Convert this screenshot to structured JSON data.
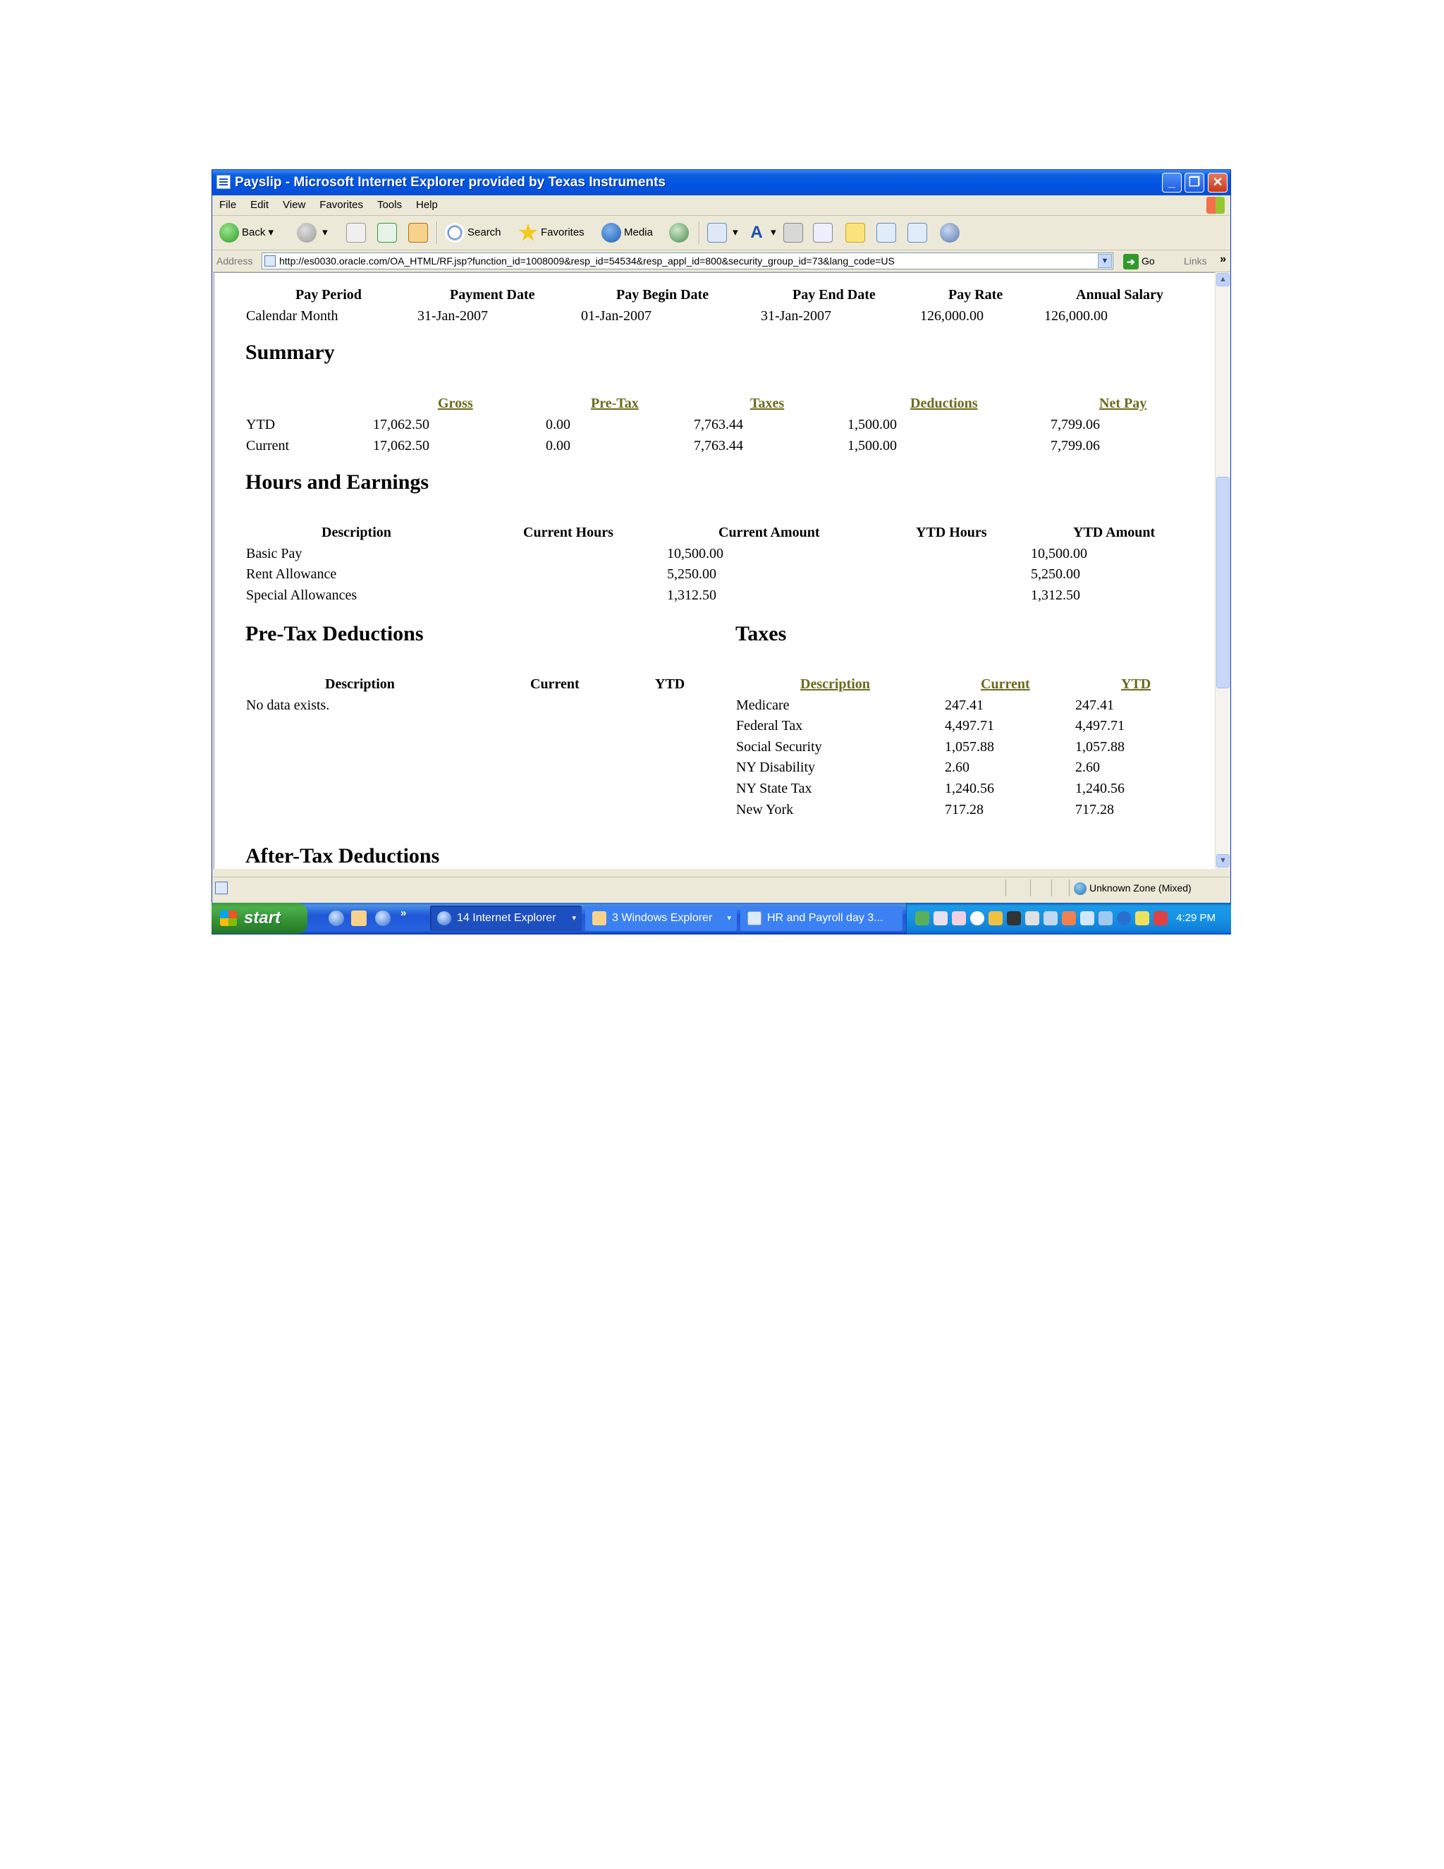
{
  "window": {
    "title": "Payslip - Microsoft Internet Explorer provided by Texas Instruments",
    "min_glyph": "_",
    "max_glyph": "❐",
    "close_glyph": "✕"
  },
  "menu": [
    "File",
    "Edit",
    "View",
    "Favorites",
    "Tools",
    "Help"
  ],
  "toolbar": {
    "back": "Back",
    "search": "Search",
    "favorites": "Favorites",
    "media": "Media",
    "font_glyph": "A"
  },
  "address": {
    "label": "Address",
    "url": "http://es0030.oracle.com/OA_HTML/RF.jsp?function_id=1008009&resp_id=54534&resp_appl_id=800&security_group_id=73&lang_code=US",
    "go": "Go",
    "links": "Links",
    "chevron": "»",
    "dropdown_glyph": "▼"
  },
  "payslip": {
    "header_cols": [
      "Pay Period",
      "Payment Date",
      "Pay Begin Date",
      "Pay End Date",
      "Pay Rate",
      "Annual Salary"
    ],
    "header_vals": [
      "Calendar Month",
      "31-Jan-2007",
      "01-Jan-2007",
      "31-Jan-2007",
      "126,000.00",
      "126,000.00"
    ],
    "summary": {
      "title": "Summary",
      "cols": [
        "Gross",
        "Pre-Tax",
        "Taxes",
        "Deductions",
        "Net Pay"
      ],
      "rows": [
        {
          "label": "YTD",
          "vals": [
            "17,062.50",
            "0.00",
            "7,763.44",
            "1,500.00",
            "7,799.06"
          ]
        },
        {
          "label": "Current",
          "vals": [
            "17,062.50",
            "0.00",
            "7,763.44",
            "1,500.00",
            "7,799.06"
          ]
        }
      ]
    },
    "hours": {
      "title": "Hours and Earnings",
      "cols": [
        "Description",
        "Current Hours",
        "Current Amount",
        "YTD Hours",
        "YTD Amount"
      ],
      "rows": [
        {
          "desc": "Basic Pay",
          "cur_amt": "10,500.00",
          "ytd_amt": "10,500.00"
        },
        {
          "desc": "Rent Allowance",
          "cur_amt": "5,250.00",
          "ytd_amt": "5,250.00"
        },
        {
          "desc": "Special Allowances",
          "cur_amt": "1,312.50",
          "ytd_amt": "1,312.50"
        }
      ]
    },
    "pretax": {
      "title": "Pre-Tax Deductions",
      "cols": [
        "Description",
        "Current",
        "YTD"
      ],
      "empty": "No data exists."
    },
    "taxes": {
      "title": "Taxes",
      "cols": [
        "Description",
        "Current",
        "YTD"
      ],
      "rows": [
        {
          "desc": "Medicare",
          "cur": "247.41",
          "ytd": "247.41"
        },
        {
          "desc": "Federal Tax",
          "cur": "4,497.71",
          "ytd": "4,497.71"
        },
        {
          "desc": "Social Security",
          "cur": "1,057.88",
          "ytd": "1,057.88"
        },
        {
          "desc": "NY Disability",
          "cur": "2.60",
          "ytd": "2.60"
        },
        {
          "desc": "NY State Tax",
          "cur": "1,240.56",
          "ytd": "1,240.56"
        },
        {
          "desc": "New York",
          "cur": "717.28",
          "ytd": "717.28"
        }
      ]
    },
    "aftertax_title": "After-Tax Deductions"
  },
  "status": {
    "zone": "Unknown Zone (Mixed)"
  },
  "taskbar": {
    "start": "start",
    "chevron": "»",
    "tasks": [
      "14 Internet Explorer",
      "3 Windows Explorer",
      "HR and Payroll day 3..."
    ],
    "dropdown_glyph": "▾",
    "clock": "4:29 PM"
  },
  "colors": {
    "link": "#6b6b1e",
    "title_blue": "#0054e3",
    "taskbar_blue": "#2157d7",
    "start_green": "#2f8a2f"
  }
}
